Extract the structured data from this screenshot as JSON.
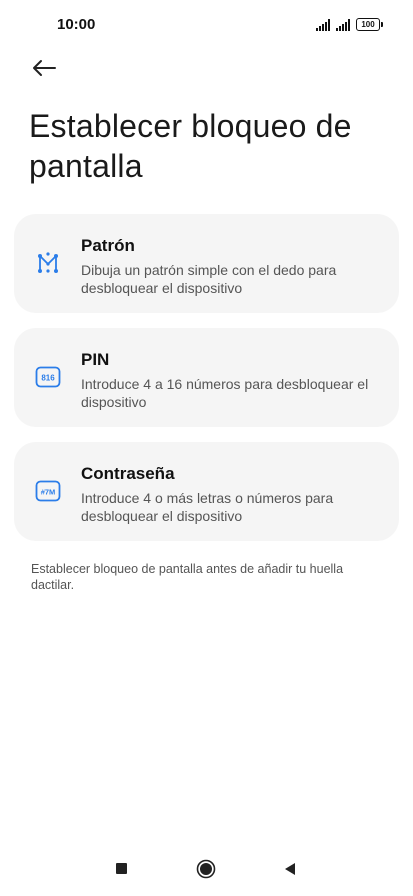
{
  "status_bar": {
    "time": "10:00",
    "battery_level": "100",
    "icons": [
      "signal-icon",
      "signal-icon",
      "battery-icon"
    ]
  },
  "header": {
    "back_icon": "arrow-left-icon",
    "title": "Establecer bloqueo de pantalla"
  },
  "options": [
    {
      "id": "pattern",
      "icon": "pattern-icon",
      "title": "Patrón",
      "description": "Dibuja un patrón simple con el dedo para desbloquear el dispositivo"
    },
    {
      "id": "pin",
      "icon": "pin-icon",
      "icon_text": "816",
      "title": "PIN",
      "description": "Introduce 4 a 16 números para desbloquear el dispositivo"
    },
    {
      "id": "password",
      "icon": "password-icon",
      "icon_text": "#7M",
      "title": "Contraseña",
      "description": "Introduce 4 o más letras o números para desbloquear el dispositivo"
    }
  ],
  "footer_note": "Establecer bloqueo de pantalla antes de añadir tu huella dactilar.",
  "navigation_bar": {
    "icons": [
      "recent-apps-icon",
      "home-icon",
      "back-triangle-icon"
    ]
  },
  "colors": {
    "accent": "#2b7de9",
    "card_background": "#f5f5f5",
    "text_primary": "#111111",
    "text_secondary": "#555555"
  }
}
